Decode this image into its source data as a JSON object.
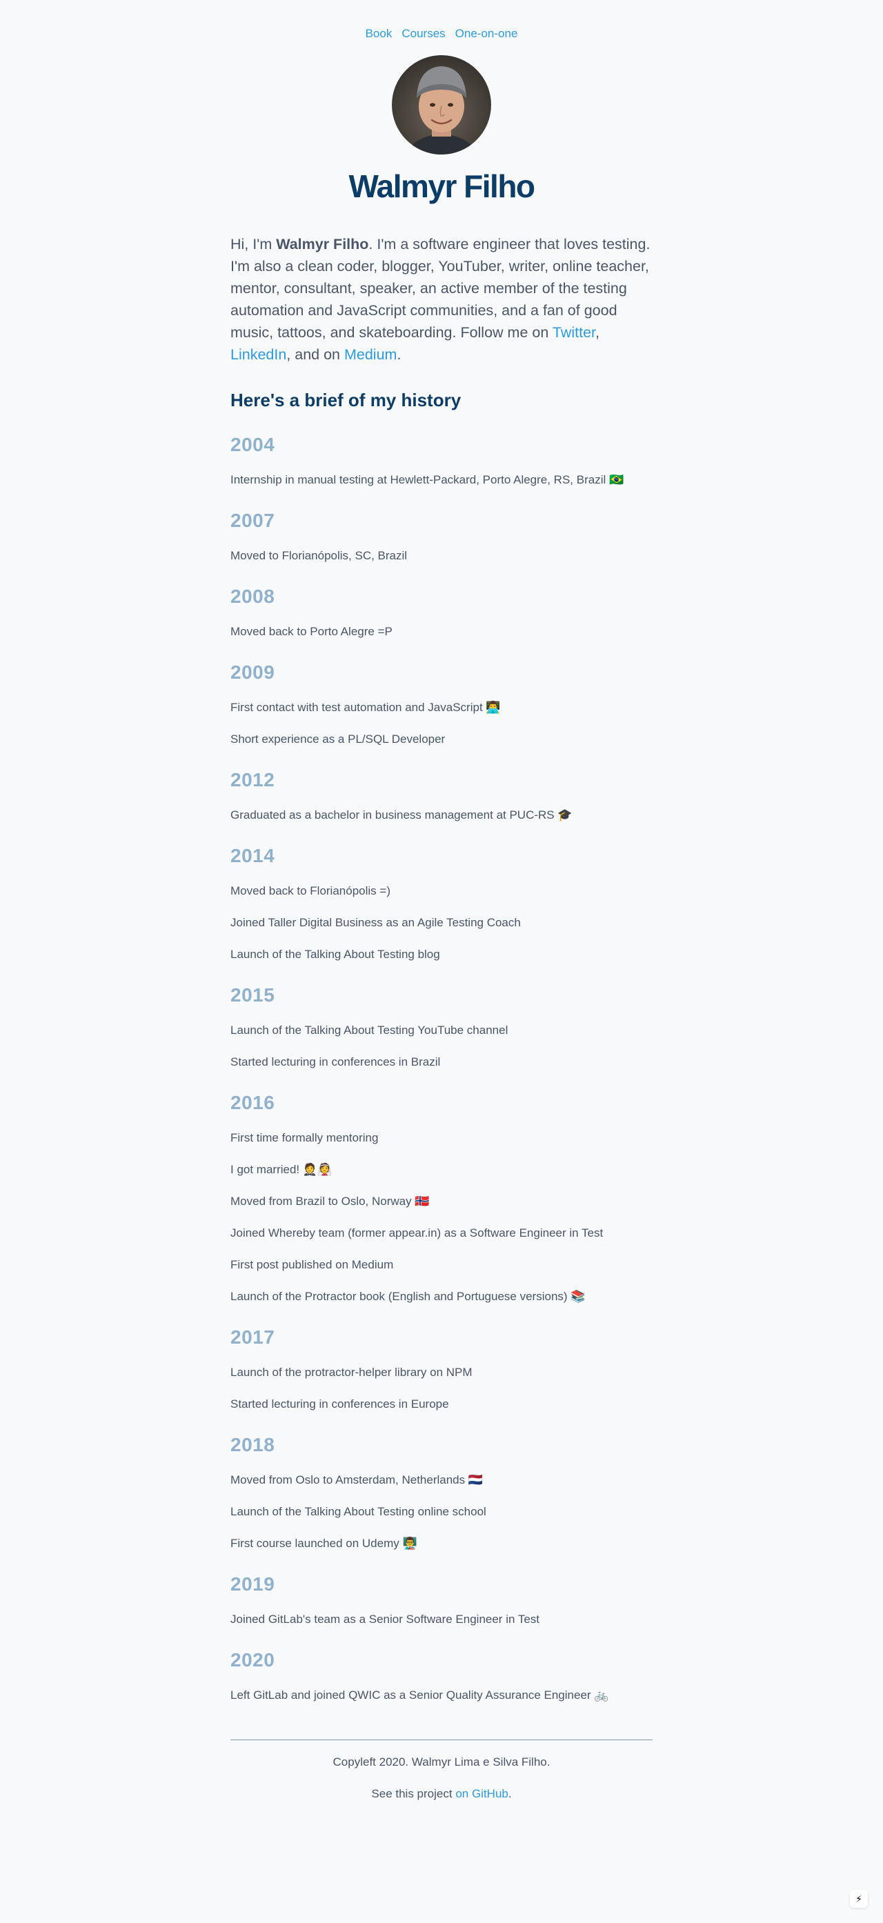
{
  "nav": {
    "items": [
      {
        "label": "Book"
      },
      {
        "label": "Courses"
      },
      {
        "label": "One-on-one"
      }
    ]
  },
  "header": {
    "name": "Walmyr Filho"
  },
  "intro": {
    "prefix": "Hi, I'm ",
    "name": "Walmyr Filho",
    "body": ". I'm a software engineer that loves testing. I'm also a clean coder, blogger, YouTuber, writer, online teacher, mentor, consultant, speaker, an active member of the testing automation and JavaScript communities, and a fan of good music, tattoos, and skateboarding. Follow me on ",
    "twitter_label": "Twitter",
    "sep1": ", ",
    "linkedin_label": "LinkedIn",
    "sep2": ", and on ",
    "medium_label": "Medium",
    "end": "."
  },
  "history": {
    "title": "Here's a brief of my history",
    "years": [
      {
        "year": "2004",
        "events": [
          "Internship in manual testing at Hewlett-Packard, Porto Alegre, RS, Brazil 🇧🇷"
        ]
      },
      {
        "year": "2007",
        "events": [
          "Moved to Florianópolis, SC, Brazil"
        ]
      },
      {
        "year": "2008",
        "events": [
          "Moved back to Porto Alegre =P"
        ]
      },
      {
        "year": "2009",
        "events": [
          "First contact with test automation and JavaScript 👨‍💻",
          "Short experience as a PL/SQL Developer"
        ]
      },
      {
        "year": "2012",
        "events": [
          "Graduated as a bachelor in business management at PUC-RS 🎓"
        ]
      },
      {
        "year": "2014",
        "events": [
          "Moved back to Florianópolis =)",
          "Joined Taller Digital Business as an Agile Testing Coach",
          "Launch of the Talking About Testing blog"
        ]
      },
      {
        "year": "2015",
        "events": [
          "Launch of the Talking About Testing YouTube channel",
          "Started lecturing in conferences in Brazil"
        ]
      },
      {
        "year": "2016",
        "events": [
          "First time formally mentoring",
          "I got married! 🤵👰",
          "Moved from Brazil to Oslo, Norway 🇳🇴",
          "Joined Whereby team (former appear.in) as a Software Engineer in Test",
          "First post published on Medium",
          "Launch of the Protractor book (English and Portuguese versions) 📚"
        ]
      },
      {
        "year": "2017",
        "events": [
          "Launch of the protractor-helper library on NPM",
          "Started lecturing in conferences in Europe"
        ]
      },
      {
        "year": "2018",
        "events": [
          "Moved from Oslo to Amsterdam, Netherlands 🇳🇱",
          "Launch of the Talking About Testing online school",
          "First course launched on Udemy 👨‍🏫"
        ]
      },
      {
        "year": "2019",
        "events": [
          "Joined GitLab's team as a Senior Software Engineer in Test"
        ]
      },
      {
        "year": "2020",
        "events": [
          "Left GitLab and joined QWIC as a Senior Quality Assurance Engineer 🚲"
        ]
      }
    ]
  },
  "footer": {
    "copyleft": "Copyleft 2020. Walmyr Lima e Silva Filho.",
    "project_prefix": "See this project ",
    "github_label": "on GitHub",
    "project_suffix": "."
  },
  "colors": {
    "link": "#2b9be0",
    "heading": "#0c3d66",
    "year": "#8fb1cc",
    "text": "#4a5568",
    "background": "#f8f9fa"
  },
  "icons": {
    "bolt_button": "bolt-icon"
  }
}
